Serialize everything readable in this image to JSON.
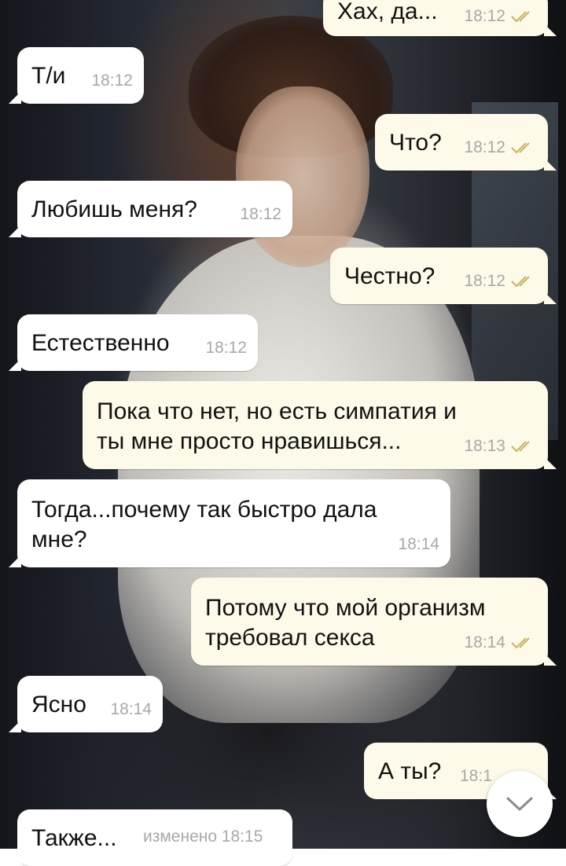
{
  "messages": [
    {
      "dir": "out",
      "text": "Хах, да...",
      "time": "18:12",
      "read": true
    },
    {
      "dir": "in",
      "text": "Т/и",
      "time": "18:12"
    },
    {
      "dir": "out",
      "text": "Что?",
      "time": "18:12",
      "read": true
    },
    {
      "dir": "in",
      "text": "Любишь меня?",
      "time": "18:12"
    },
    {
      "dir": "out",
      "text": "Честно?",
      "time": "18:12",
      "read": true
    },
    {
      "dir": "in",
      "text": "Естественно",
      "time": "18:12"
    },
    {
      "dir": "out",
      "text": "Пока что нет, но есть симпатия и\nты мне просто нравишься...",
      "time": "18:13",
      "read": true
    },
    {
      "dir": "in",
      "text": "Тогда...почему так быстро дала\nмне?",
      "time": "18:14"
    },
    {
      "dir": "out",
      "text": "Потому что мой организм\nтребовал секса",
      "time": "18:14",
      "read": true
    },
    {
      "dir": "in",
      "text": "Ясно",
      "time": "18:14"
    },
    {
      "dir": "out",
      "text": "А ты?",
      "time": "18:1",
      "read": false
    },
    {
      "dir": "in",
      "text": "Также...",
      "time": "изменено 18:15"
    }
  ],
  "scroll_button": {
    "icon": "chevron-down-icon"
  },
  "colors": {
    "incoming": "#ffffff",
    "outgoing": "#fdfae9",
    "read_ticks": "#c9b265",
    "time": "#a8a8a8"
  }
}
